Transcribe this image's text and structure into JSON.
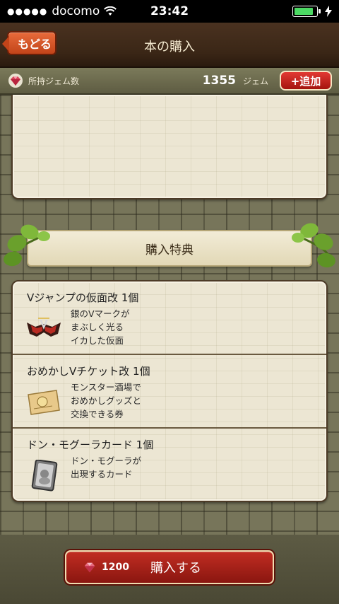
{
  "status_bar": {
    "carrier": "docomo",
    "time": "23:42",
    "signal_icon": "signal-dots-icon",
    "wifi_icon": "wifi-icon",
    "battery_level": 0.85,
    "charging_icon": "bolt-icon"
  },
  "header": {
    "back_label": "もどる",
    "title": "本の購入"
  },
  "gem_bar": {
    "label": "所持ジェム数",
    "count": "1355",
    "unit": "ジェム",
    "add_label": "+追加",
    "icon": "gem-icon"
  },
  "bonus": {
    "title": "購入特典",
    "items": [
      {
        "title": "Vジャンプの仮面改 1個",
        "desc": [
          "銀のVマークが",
          "まぶしく光る",
          "イカした仮面"
        ],
        "icon": "mask-icon"
      },
      {
        "title": "おめかしVチケット改 1個",
        "desc": [
          "モンスター酒場で",
          "おめかしグッズと",
          "交換できる券"
        ],
        "icon": "ticket-icon"
      },
      {
        "title": "ドン・モグーラカード 1個",
        "desc": [
          "ドン・モグーラが",
          "出現するカード"
        ],
        "icon": "card-icon"
      }
    ]
  },
  "buy": {
    "price": "1200",
    "label": "購入する",
    "icon": "gem-icon"
  },
  "colors": {
    "accent_red": "#c12d22",
    "header_brown": "#3a2616",
    "back_orange": "#e86b3b",
    "battery_green": "#4cd964"
  }
}
